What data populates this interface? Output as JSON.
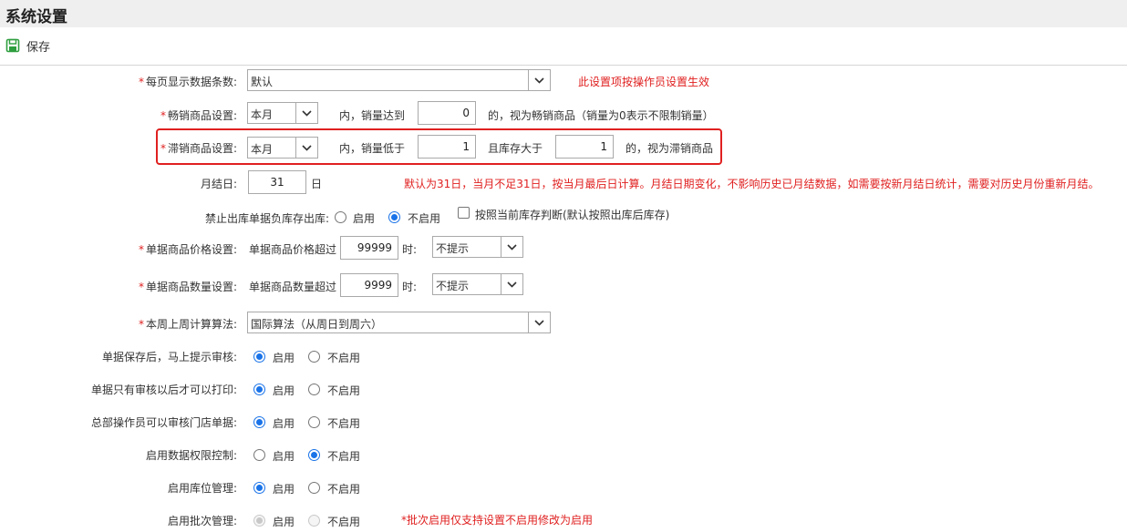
{
  "page": {
    "title": "系统设置"
  },
  "toolbar": {
    "save_label": "保存",
    "save_icon": "save-icon"
  },
  "rows": {
    "page_size": {
      "label": "每页显示数据条数:",
      "value": "默认",
      "note": "此设置项按操作员设置生效"
    },
    "bestseller": {
      "label": "畅销商品设置:",
      "period": "本月",
      "text1": "内，销量达到",
      "qty": "0",
      "text2": "的，视为畅销商品（销量为0表示不限制销量）"
    },
    "slowseller": {
      "label": "滞销商品设置:",
      "period": "本月",
      "text1": "内，销量低于",
      "qty": "1",
      "text2": "且库存大于",
      "stock": "1",
      "text3": "的，视为滞销商品"
    },
    "month_end": {
      "label": "月结日:",
      "value": "31",
      "unit": "日",
      "note": "默认为31日，当月不足31日，按当月最后日计算。月结日期变化，不影响历史已月结数据，如需要按新月结日统计，需要对历史月份重新月结。"
    },
    "neg_stock": {
      "label": "禁止出库单据负库存出库:",
      "opt_on": "启用",
      "opt_off": "不启用",
      "selected": "不启用",
      "check_label": "按照当前库存判断(默认按照出库后库存)",
      "checked": false
    },
    "price": {
      "label": "单据商品价格设置:",
      "text1": "单据商品价格超过",
      "value": "99999",
      "text2": "时:",
      "action": "不提示"
    },
    "qty": {
      "label": "单据商品数量设置:",
      "text1": "单据商品数量超过",
      "value": "9999",
      "text2": "时:",
      "action": "不提示"
    },
    "week": {
      "label": "本周上周计算算法:",
      "value": "国际算法（从周日到周六）"
    },
    "audit_prompt": {
      "label": "单据保存后，马上提示审核:",
      "opt_on": "启用",
      "opt_off": "不启用",
      "selected": "启用"
    },
    "print_after_audit": {
      "label": "单据只有审核以后才可以打印:",
      "opt_on": "启用",
      "opt_off": "不启用",
      "selected": "启用"
    },
    "hq_audit": {
      "label": "总部操作员可以审核门店单据:",
      "opt_on": "启用",
      "opt_off": "不启用",
      "selected": "启用"
    },
    "data_perm": {
      "label": "启用数据权限控制:",
      "opt_on": "启用",
      "opt_off": "不启用",
      "selected": "不启用"
    },
    "location": {
      "label": "启用库位管理:",
      "opt_on": "启用",
      "opt_off": "不启用",
      "selected": "启用"
    },
    "batch": {
      "label": "启用批次管理:",
      "opt_on": "启用",
      "opt_off": "不启用",
      "selected": "启用",
      "note": "*批次启用仅支持设置不启用修改为启用"
    }
  },
  "colors": {
    "accent": "#1a73e8",
    "warning": "#e02020",
    "save_icon": "#2e9e3e"
  }
}
